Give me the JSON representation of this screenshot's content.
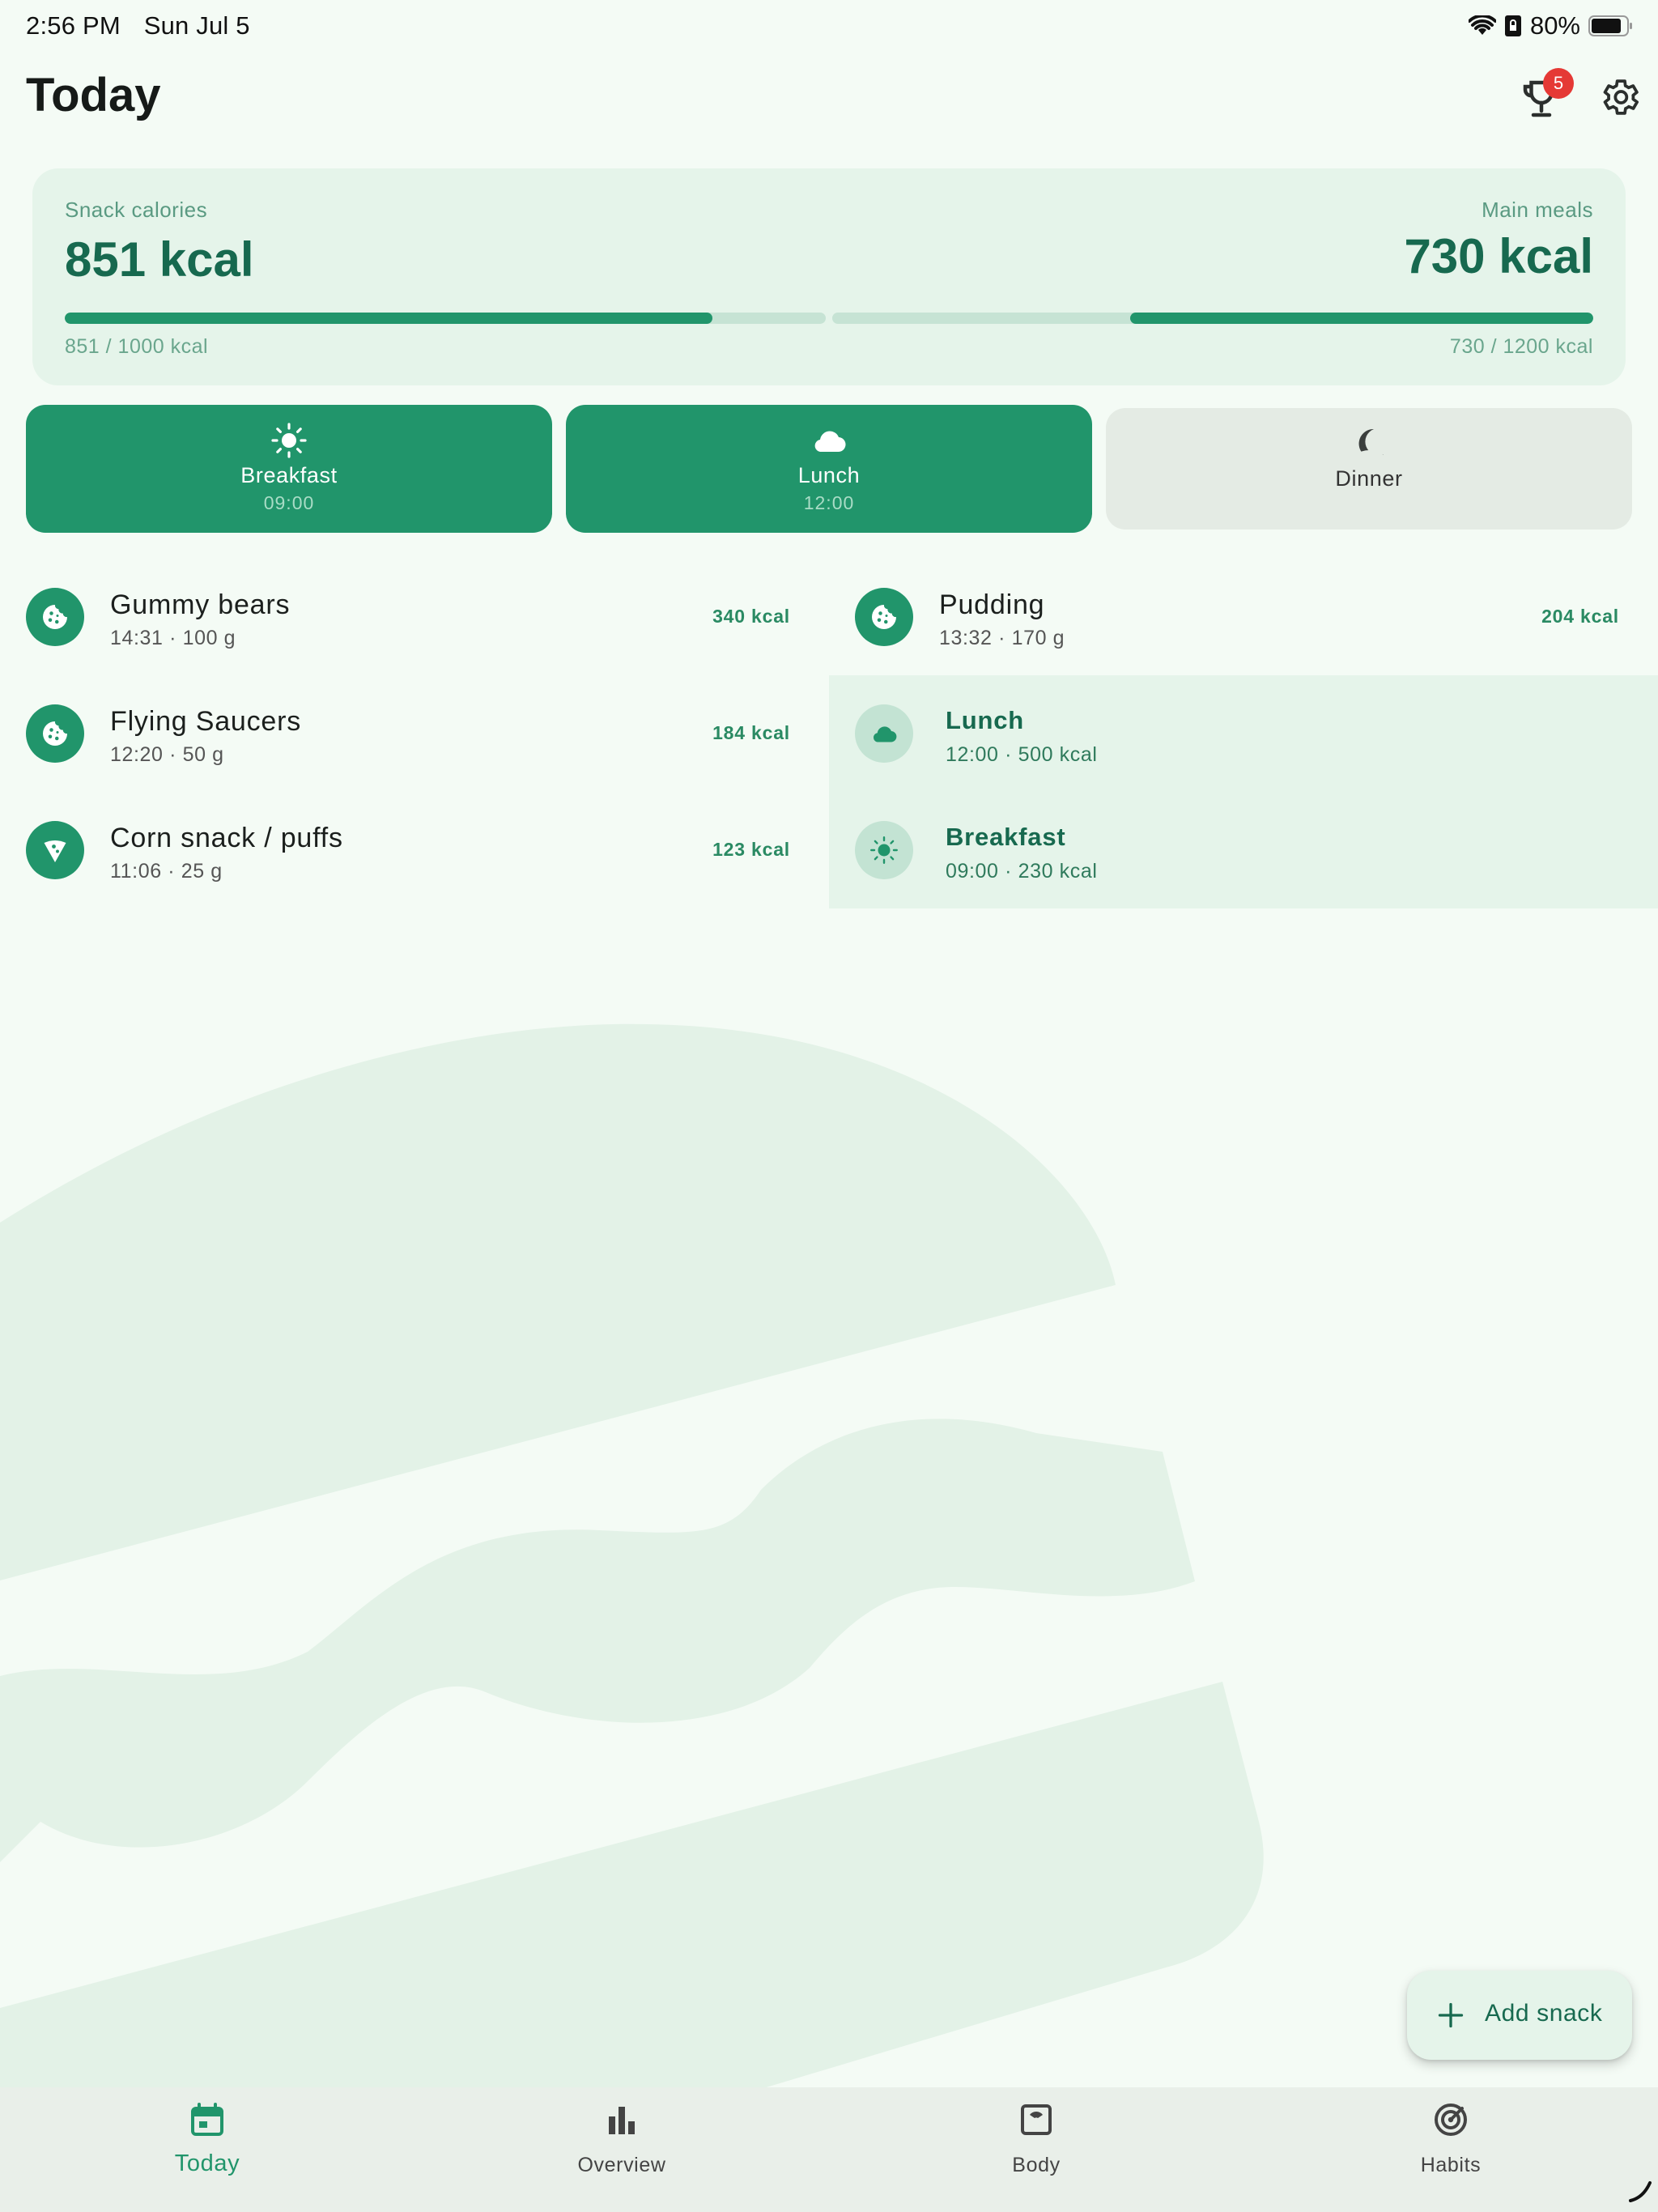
{
  "status_bar": {
    "time": "2:56 PM",
    "date": "Sun Jul 5",
    "battery": "80%"
  },
  "header": {
    "title": "Today",
    "trophy_badge": "5"
  },
  "summary": {
    "snack_label": "Snack calories",
    "snack_value": "851 kcal",
    "snack_sub": "851 / 1000 kcal",
    "snack_progress": 0.851,
    "main_label": "Main meals",
    "main_value": "730 kcal",
    "main_sub": "730 / 1200 kcal",
    "main_progress": 0.608
  },
  "meals": [
    {
      "name": "Breakfast",
      "time": "09:00",
      "icon": "sun-icon",
      "done": true
    },
    {
      "name": "Lunch",
      "time": "12:00",
      "icon": "cloud-icon",
      "done": true
    },
    {
      "name": "Dinner",
      "time": "",
      "icon": "moon-icon",
      "done": false
    }
  ],
  "entries_left": [
    {
      "name": "Gummy bears",
      "sub": "14:31 · 100 g",
      "kcal": "340 kcal",
      "icon": "cookie-icon"
    },
    {
      "name": "Flying Saucers",
      "sub": "12:20 · 50 g",
      "kcal": "184 kcal",
      "icon": "cookie-icon"
    },
    {
      "name": "Corn snack / puffs",
      "sub": "11:06 · 25 g",
      "kcal": "123 kcal",
      "icon": "pizza-icon"
    }
  ],
  "entries_right": [
    {
      "name": "Pudding",
      "sub": "13:32 · 170 g",
      "kcal": "204 kcal",
      "icon": "cookie-icon"
    },
    {
      "name": "Lunch",
      "sub": "12:00 · 500 kcal",
      "icon": "cloud-icon"
    },
    {
      "name": "Breakfast",
      "sub": "09:00 · 230 kcal",
      "icon": "sun-icon"
    }
  ],
  "fab": {
    "label": "Add snack"
  },
  "nav": [
    {
      "label": "Today",
      "icon": "calendar-icon",
      "active": true
    },
    {
      "label": "Overview",
      "icon": "bar-chart-icon",
      "active": false
    },
    {
      "label": "Body",
      "icon": "scale-icon",
      "active": false
    },
    {
      "label": "Habits",
      "icon": "target-icon",
      "active": false
    }
  ],
  "colors": {
    "accent": "#21956b",
    "accent_dark": "#17694f",
    "card": "#e5f4ea",
    "background": "#f4fbf5"
  }
}
